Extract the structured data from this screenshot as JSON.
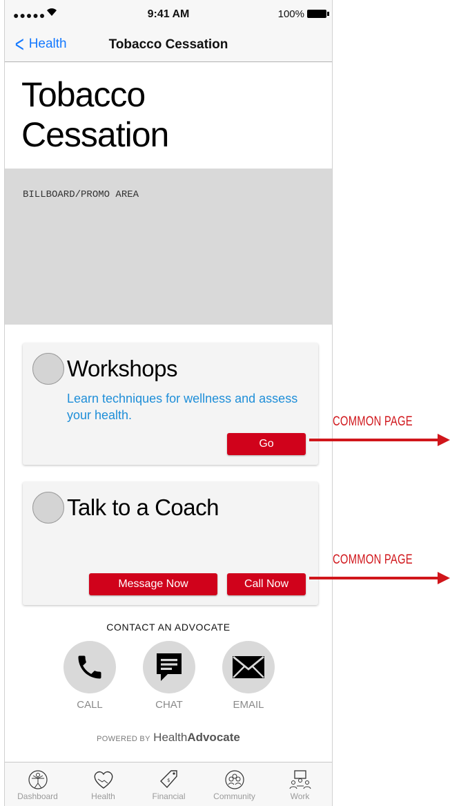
{
  "status_bar": {
    "signal": "●●●●●",
    "time": "9:41 AM",
    "battery": "100%"
  },
  "nav": {
    "back_label": "Health",
    "title": "Tobacco Cessation"
  },
  "page": {
    "title_line1": "Tobacco",
    "title_line2": "Cessation"
  },
  "billboard": {
    "label": "BILLBOARD/PROMO AREA"
  },
  "workshops": {
    "title": "Workshops",
    "description": "Learn techniques for wellness and assess your health.",
    "button": "Go"
  },
  "coach": {
    "title": "Talk to a Coach",
    "message_button": "Message Now",
    "call_button": "Call Now"
  },
  "contact": {
    "heading": "CONTACT AN ADVOCATE",
    "items": [
      {
        "label": "CALL",
        "icon": "phone-icon"
      },
      {
        "label": "CHAT",
        "icon": "chat-icon"
      },
      {
        "label": "EMAIL",
        "icon": "email-icon"
      }
    ]
  },
  "powered": {
    "prefix": "POWERED BY",
    "brand_light": "Health",
    "brand_bold": "Advocate"
  },
  "tabbar": {
    "tabs": [
      {
        "label": "Dashboard",
        "icon": "vitruvian-icon"
      },
      {
        "label": "Health",
        "icon": "heart-hands-icon"
      },
      {
        "label": "Financial",
        "icon": "price-tag-icon"
      },
      {
        "label": "Community",
        "icon": "group-icon"
      },
      {
        "label": "Work",
        "icon": "meeting-icon"
      }
    ]
  },
  "annotations": {
    "workshops_link": "COMMON PAGE",
    "coach_link": "COMMON PAGE"
  },
  "colors": {
    "accent_red": "#d0021b",
    "link_blue": "#1479ff",
    "annotation_red": "#d0161b"
  }
}
